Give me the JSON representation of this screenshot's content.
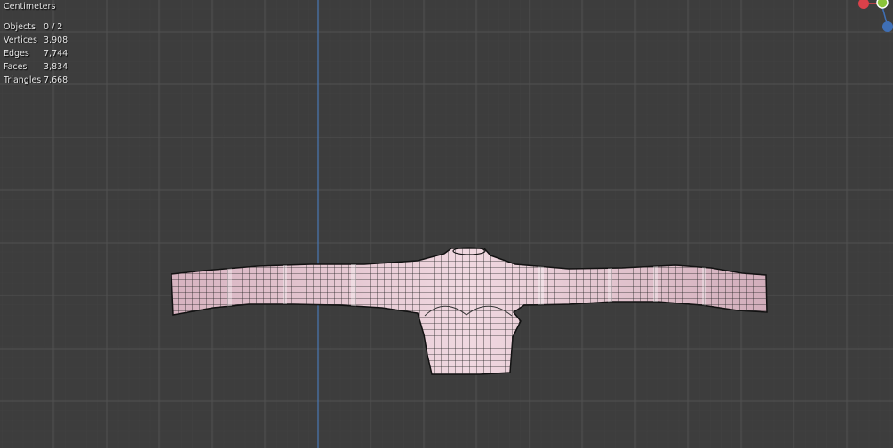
{
  "viewport": {
    "unit_label": "Centimeters",
    "stats": [
      {
        "key": "Objects",
        "value": "0 / 2"
      },
      {
        "key": "Vertices",
        "value": "3,908"
      },
      {
        "key": "Edges",
        "value": "7,744"
      },
      {
        "key": "Faces",
        "value": "3,834"
      },
      {
        "key": "Triangles",
        "value": "7,668"
      }
    ]
  },
  "colors": {
    "background": "#3d3d3d",
    "grid_minor": "#4a4a4a",
    "grid_major": "#545454",
    "z_axis": "#4a78b3",
    "mesh_fill": "#e6c3cf",
    "wire": "#1a1a1a",
    "gizmo_x": "#d9414a",
    "gizmo_y": "#8ac43a",
    "gizmo_z": "#3f6fb5"
  },
  "mesh": {
    "name": "sweater-mesh"
  },
  "gizmo": {
    "icons": [
      "gizmo-x-icon",
      "gizmo-y-icon",
      "gizmo-z-icon"
    ]
  }
}
